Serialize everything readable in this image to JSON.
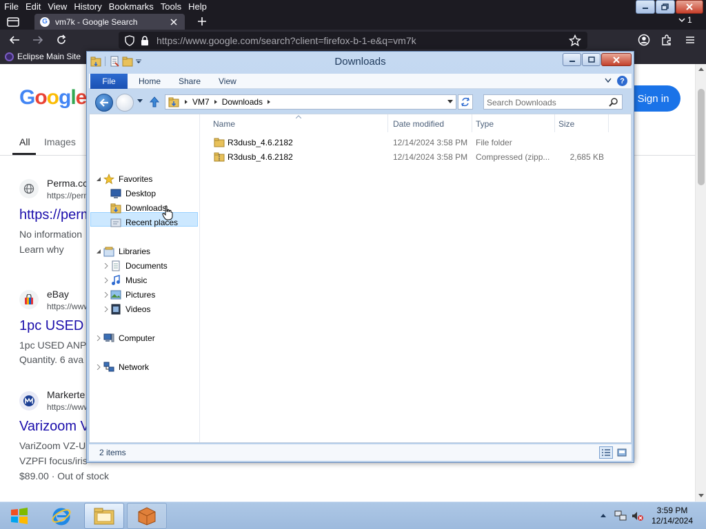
{
  "firefox": {
    "menu": [
      "File",
      "Edit",
      "View",
      "History",
      "Bookmarks",
      "Tools",
      "Help"
    ],
    "tab_title": "vm7k - Google Search",
    "tab_count": "1",
    "url": "https://www.google.com/search?client=firefox-b-1-e&q=vm7k",
    "bookmark": "Eclipse Main Site"
  },
  "google": {
    "logo": "Google",
    "sign_in": "Sign in",
    "tabs": [
      "All",
      "Images"
    ],
    "results": [
      {
        "site": "Perma.cc",
        "url": "https://perma.cc",
        "title": "https://perm",
        "snippet": "No information",
        "extra": "Learn why"
      },
      {
        "site": "eBay",
        "url": "https://www",
        "title": "1pc USED",
        "snippet": "1pc USED ANP",
        "extra": "Quantity. 6 ava"
      },
      {
        "site": "Markerte",
        "url": "https://www",
        "title": "Varizoom V",
        "snippet": "VariZoom VZ-U",
        "extra": "VZPFI focus/iris",
        "price": "$89.00 · Out of stock"
      }
    ]
  },
  "explorer": {
    "title": "Downloads",
    "ribbon": {
      "file": "File",
      "home": "Home",
      "share": "Share",
      "view": "View",
      "help": "?"
    },
    "address": [
      "VM7",
      "Downloads"
    ],
    "search_placeholder": "Search Downloads",
    "nav": {
      "favorites": "Favorites",
      "desktop": "Desktop",
      "downloads": "Downloads",
      "recent": "Recent places",
      "libraries": "Libraries",
      "documents": "Documents",
      "music": "Music",
      "pictures": "Pictures",
      "videos": "Videos",
      "computer": "Computer",
      "network": "Network"
    },
    "columns": {
      "name": "Name",
      "date": "Date modified",
      "type": "Type",
      "size": "Size"
    },
    "files": [
      {
        "name": "R3dusb_4.6.2182",
        "date": "12/14/2024 3:58 PM",
        "type": "File folder",
        "size": ""
      },
      {
        "name": "R3dusb_4.6.2182",
        "date": "12/14/2024 3:58 PM",
        "type": "Compressed (zipp...",
        "size": "2,685 KB"
      }
    ],
    "item_count": "2 items"
  },
  "taskbar": {
    "time": "3:59 PM",
    "date": "12/14/2024"
  },
  "colors": {
    "selection": "#cce8ff",
    "link": "#1a0dab",
    "accent": "#1a73e8"
  }
}
